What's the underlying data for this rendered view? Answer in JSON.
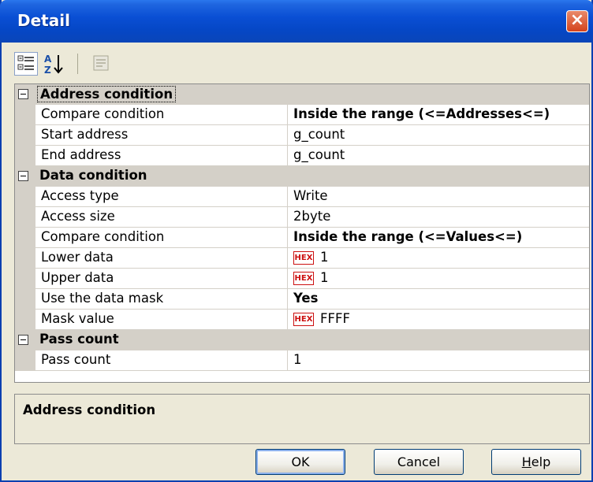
{
  "window": {
    "title": "Detail",
    "close_glyph": "×"
  },
  "toolbar": {
    "icons": [
      "categorized-view-icon",
      "alphabetical-sort-icon",
      "property-pages-icon"
    ],
    "sort_glyph_top": "A",
    "sort_glyph_bottom": "Z"
  },
  "grid": {
    "categories": [
      {
        "label": "Address condition",
        "properties": [
          {
            "name": "Compare condition",
            "value": "Inside the range (<=Addresses<=)",
            "bold": true
          },
          {
            "name": "Start address",
            "value": "g_count"
          },
          {
            "name": "End address",
            "value": "g_count"
          }
        ]
      },
      {
        "label": "Data condition",
        "properties": [
          {
            "name": "Access type",
            "value": "Write"
          },
          {
            "name": "Access size",
            "value": "2byte"
          },
          {
            "name": "Compare condition",
            "value": "Inside the range (<=Values<=)",
            "bold": true
          },
          {
            "name": "Lower data",
            "hex_badge": "HEX",
            "value": "1"
          },
          {
            "name": "Upper data",
            "hex_badge": "HEX",
            "value": "1"
          },
          {
            "name": "Use the data mask",
            "value": "Yes",
            "bold": true
          },
          {
            "name": "Mask value",
            "hex_badge": "HEX",
            "value": "FFFF"
          }
        ]
      },
      {
        "label": "Pass count",
        "properties": [
          {
            "name": "Pass count",
            "value": "1"
          }
        ]
      }
    ]
  },
  "description": {
    "text": "Address condition"
  },
  "buttons": {
    "ok": "OK",
    "cancel": "Cancel",
    "help_first": "H",
    "help_rest": "elp"
  },
  "colors": {
    "title_bar": "#0a4fd4",
    "dialog_bg": "#ece9d8",
    "category_bg": "#d4d0c8",
    "hex_badge": "#cc1010"
  }
}
